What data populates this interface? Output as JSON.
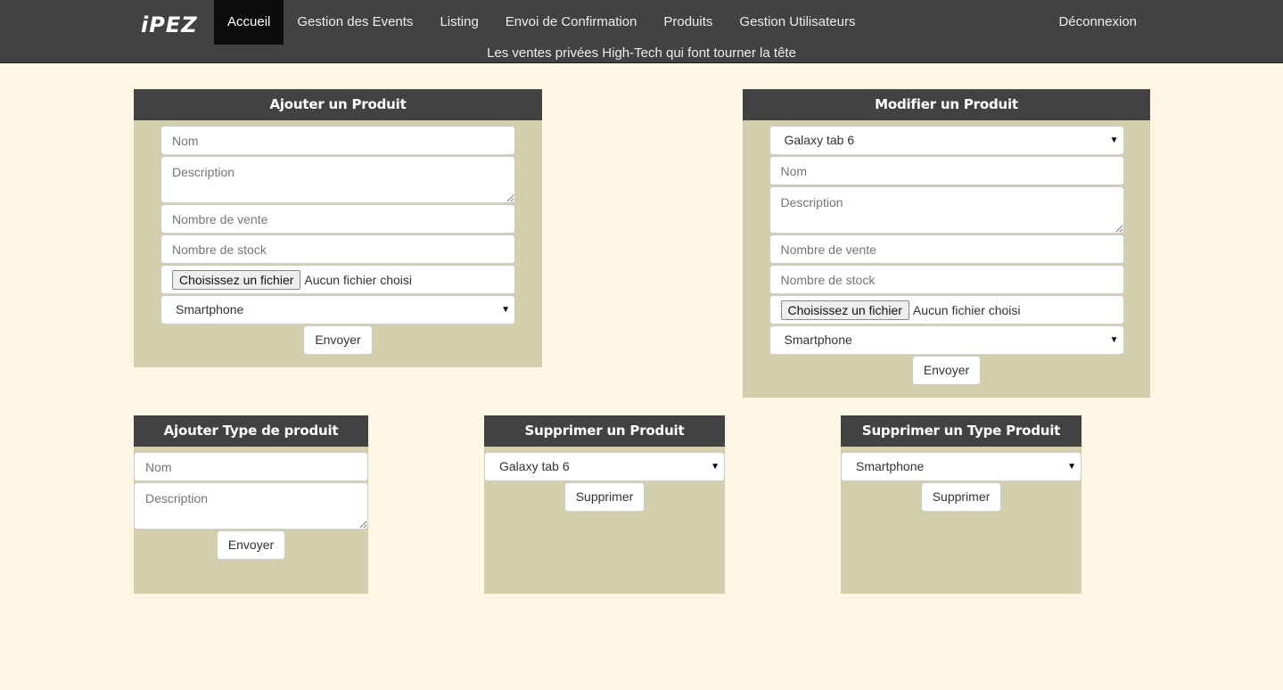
{
  "nav": {
    "brand": "iPEZ",
    "items": [
      {
        "label": "Accueil"
      },
      {
        "label": "Gestion des Events"
      },
      {
        "label": "Listing"
      },
      {
        "label": "Envoi de Confirmation"
      },
      {
        "label": "Produits"
      },
      {
        "label": "Gestion Utilisateurs"
      }
    ],
    "logout": "Déconnexion",
    "tagline": "Les ventes privées High-Tech qui font tourner la tête"
  },
  "add_product": {
    "title": "Ajouter un Produit",
    "name_ph": "Nom",
    "desc_ph": "Description",
    "sales_ph": "Nombre de vente",
    "stock_ph": "Nombre de stock",
    "file_btn": "Choisissez un fichier",
    "file_status": "Aucun fichier choisi",
    "type_selected": "Smartphone",
    "submit": "Envoyer"
  },
  "edit_product": {
    "title": "Modifier un Produit",
    "product_selected": "Galaxy tab 6",
    "name_ph": "Nom",
    "desc_ph": "Description",
    "sales_ph": "Nombre de vente",
    "stock_ph": "Nombre de stock",
    "file_btn": "Choisissez un fichier",
    "file_status": "Aucun fichier choisi",
    "type_selected": "Smartphone",
    "submit": "Envoyer"
  },
  "add_type": {
    "title": "Ajouter Type de produit",
    "name_ph": "Nom",
    "desc_ph": "Description",
    "submit": "Envoyer"
  },
  "delete_product": {
    "title": "Supprimer un Produit",
    "product_selected": "Galaxy tab 6",
    "submit": "Supprimer"
  },
  "delete_type": {
    "title": "Supprimer un Type Produit",
    "type_selected": "Smartphone",
    "submit": "Supprimer"
  },
  "icons": {
    "caret": "▼"
  }
}
